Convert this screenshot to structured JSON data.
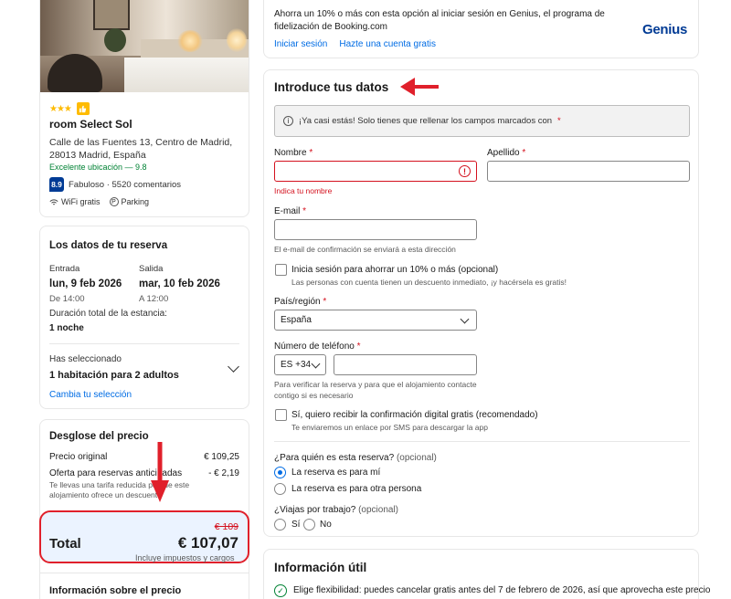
{
  "hotel": {
    "stars": "★★★",
    "thumb_icon": "thumbs-up-icon",
    "name": "room Select Sol",
    "address": "Calle de las Fuentes 13, Centro de Madrid, 28013 Madrid, España",
    "location_note": "Excelente ubicación — 9.8",
    "score": "8.9",
    "score_text": "Fabuloso · 5520 comentarios",
    "amenity_wifi": "WiFi gratis",
    "amenity_parking": "Parking",
    "parking_glyph": "P"
  },
  "reservation": {
    "title": "Los datos de tu reserva",
    "checkin_label": "Entrada",
    "checkin_date": "lun, 9 feb 2026",
    "checkin_time": "De 14:00",
    "checkout_label": "Salida",
    "checkout_date": "mar, 10 feb 2026",
    "checkout_time": "A 12:00",
    "duration_label": "Duración total de la estancia:",
    "duration_value": "1 noche",
    "selected_label": "Has seleccionado",
    "selected_value": "1 habitación para 2 adultos",
    "change_link": "Cambia tu selección"
  },
  "price": {
    "title": "Desglose del precio",
    "original_label": "Precio original",
    "original_value": "€ 109,25",
    "offer_label": "Oferta para reservas anticipadas",
    "offer_value": "- € 2,19",
    "offer_note": "Te llevas una tarifa reducida porque este alojamiento ofrece un descuento",
    "strike_price": "€ 109",
    "total_label": "Total",
    "total_value": "€ 107,07",
    "taxes_note": "Incluye impuestos y cargos",
    "info_title": "Información sobre el precio"
  },
  "genius": {
    "text": "Ahorra un 10% o más con esta opción al iniciar sesión en Genius, el programa de fidelización de Booking.com",
    "signin_link": "Iniciar sesión",
    "create_link": "Hazte una cuenta gratis",
    "logo": "Genius"
  },
  "form": {
    "title": "Introduce tus datos",
    "banner": "¡Ya casi estás! Solo tienes que rellenar los campos marcados con",
    "required_mark": "*",
    "info_glyph": "i",
    "first_name_label": "Nombre",
    "first_name_error": "Indica tu nombre",
    "error_glyph": "!",
    "last_name_label": "Apellido",
    "email_label": "E-mail",
    "email_hint": "El e-mail de confirmación se enviará a esta dirección",
    "signin_checkbox": "Inicia sesión para ahorrar un 10% o más (opcional)",
    "signin_hint": "Las personas con cuenta tienen un descuento inmediato, ¡y hacérsela es gratis!",
    "country_label": "País/región",
    "country_value": "España",
    "phone_label": "Número de teléfono",
    "phone_prefix": "ES +34",
    "phone_hint": "Para verificar la reserva y para que el alojamiento contacte contigo si es necesario",
    "sms_checkbox": "Sí, quiero recibir la confirmación digital gratis (recomendado)",
    "sms_hint": "Te enviaremos un enlace por SMS para descargar la app",
    "for_whom_label": "¿Para quién es esta reserva?",
    "optional": "(opcional)",
    "for_me": "La reserva es para mí",
    "for_other": "La reserva es para otra persona",
    "work_trip_label": "¿Viajas por trabajo?",
    "yes": "Sí",
    "no": "No"
  },
  "useful": {
    "title": "Información útil",
    "check_glyph": "✓",
    "flex_text": "Elige flexibilidad: puedes cancelar gratis antes del 7 de febrero de 2026, así que aprovecha este precio"
  },
  "colors": {
    "brand_blue": "#003b95",
    "link_blue": "#006ce4",
    "error_red": "#d4111e",
    "success_green": "#008234",
    "star_yellow": "#febb02",
    "annotation_red": "#e0202b"
  }
}
